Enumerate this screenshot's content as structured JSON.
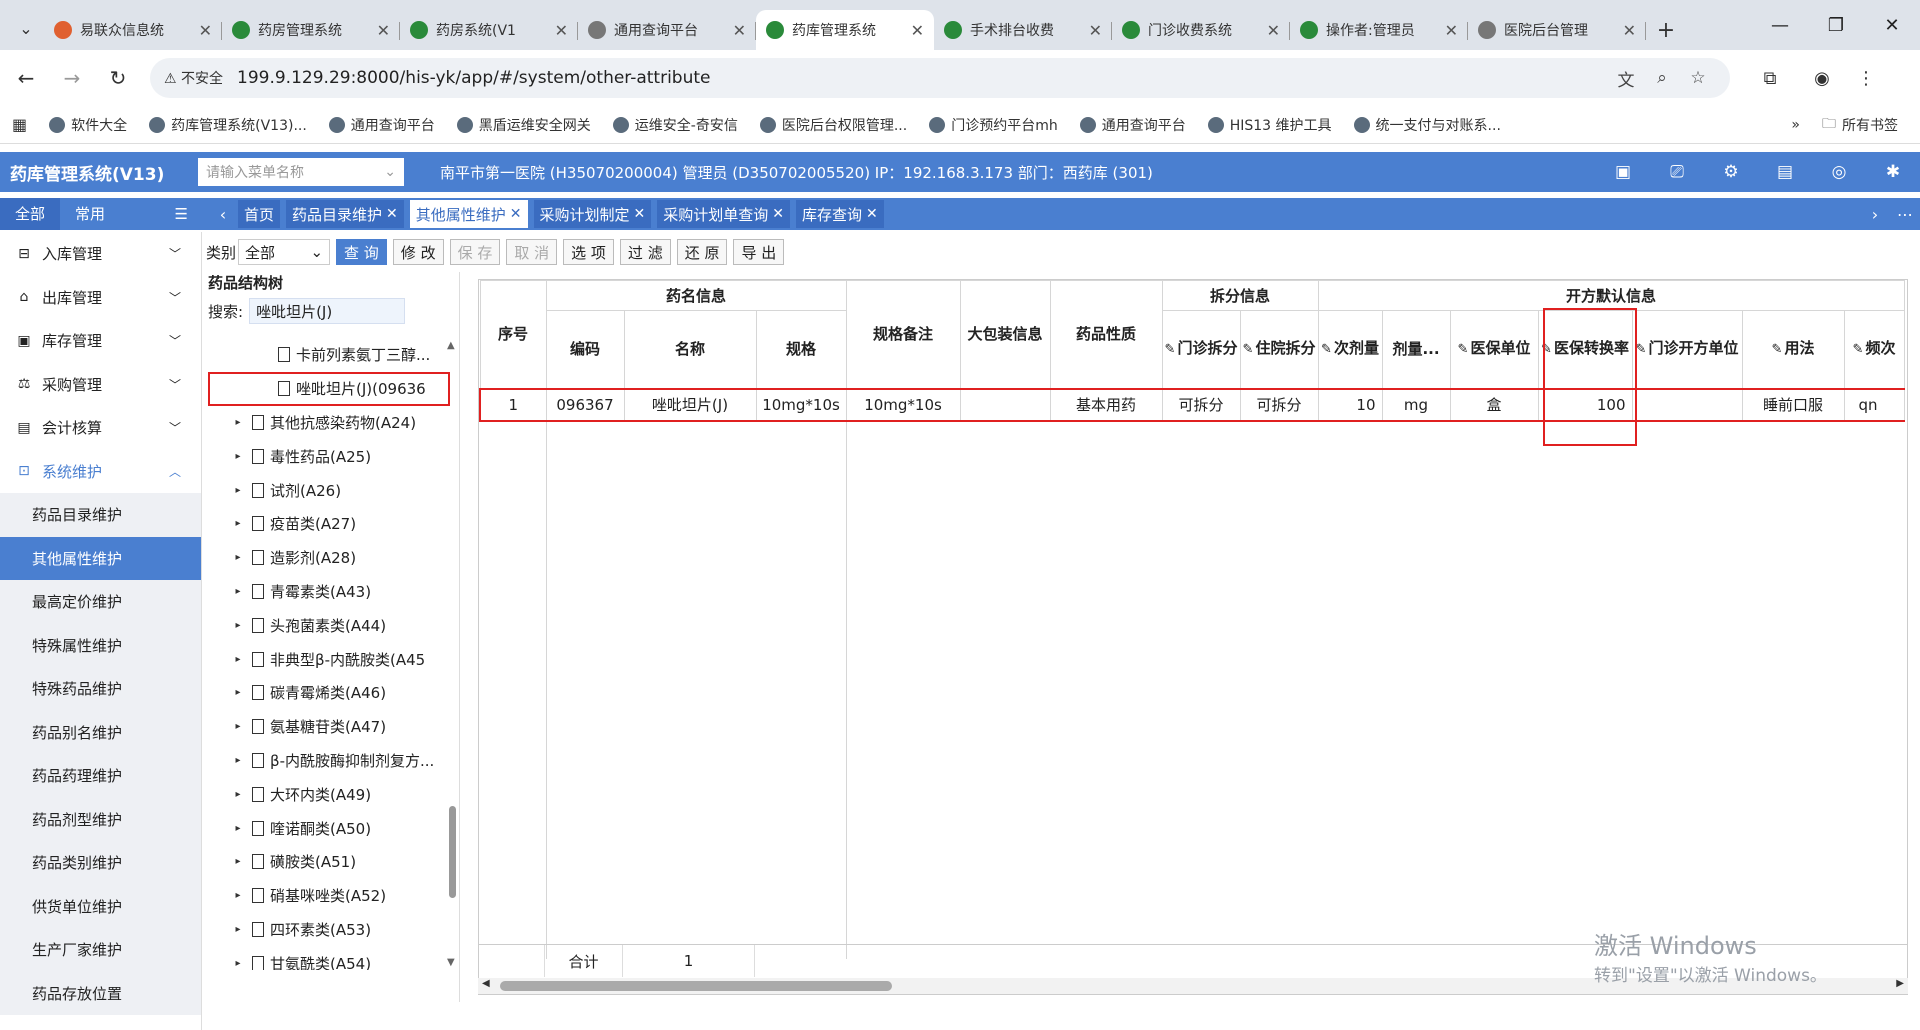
{
  "browser": {
    "tabs": [
      {
        "title": "易联众信息统",
        "color": "#e06030"
      },
      {
        "title": "药房管理系统",
        "color": "#2a8a3a"
      },
      {
        "title": "药房系统(V1",
        "color": "#2a8a3a"
      },
      {
        "title": "通用查询平台",
        "color": "#777777"
      },
      {
        "title": "药库管理系统",
        "color": "#2a8a3a",
        "active": true
      },
      {
        "title": "手术排台收费",
        "color": "#2a8a3a"
      },
      {
        "title": "门诊收费系统",
        "color": "#2a8a3a"
      },
      {
        "title": "操作者:管理员",
        "color": "#2a8a3a"
      },
      {
        "title": "医院后台管理",
        "color": "#777777"
      }
    ],
    "security_label": "不安全",
    "url": "199.9.129.29:8000/his-yk/app/#/system/other-attribute",
    "bookmarks": [
      {
        "label": "软件大全"
      },
      {
        "label": "药库管理系统(V13)..."
      },
      {
        "label": "通用查询平台"
      },
      {
        "label": "黑盾运维安全网关"
      },
      {
        "label": "运维安全-奇安信"
      },
      {
        "label": "医院后台权限管理..."
      },
      {
        "label": "门诊预约平台mh"
      },
      {
        "label": "通用查询平台"
      },
      {
        "label": "HIS13 维护工具"
      },
      {
        "label": "统一支付与对账系..."
      }
    ],
    "all_bookmarks_label": "所有书签"
  },
  "app": {
    "title": "药库管理系统(V13)",
    "menu_search_placeholder": "请输入菜单名称",
    "header_info": "南平市第一医院 (H35070200004) 管理员 (D350702005520) IP：192.168.3.173 部门：西药库 (301)",
    "accent_color": "#4a7fd0"
  },
  "left_tabs": {
    "all": "全部",
    "common": "常用"
  },
  "page_tabs": [
    {
      "label": "首页",
      "closable": false
    },
    {
      "label": "药品目录维护",
      "closable": true
    },
    {
      "label": "其他属性维护",
      "closable": true,
      "active": true
    },
    {
      "label": "采购计划制定",
      "closable": true
    },
    {
      "label": "采购计划单查询",
      "closable": true
    },
    {
      "label": "库存查询",
      "closable": true
    }
  ],
  "sidebar": {
    "groups": [
      {
        "label": "入库管理",
        "icon": "inbox-icon"
      },
      {
        "label": "出库管理",
        "icon": "outbox-icon"
      },
      {
        "label": "库存管理",
        "icon": "stock-icon"
      },
      {
        "label": "采购管理",
        "icon": "purchase-icon"
      },
      {
        "label": "会计核算",
        "icon": "accounting-icon"
      },
      {
        "label": "系统维护",
        "icon": "system-icon",
        "open": true
      }
    ],
    "sub_items": [
      {
        "label": "药品目录维护"
      },
      {
        "label": "其他属性维护",
        "active": true
      },
      {
        "label": "最高定价维护"
      },
      {
        "label": "特殊属性维护"
      },
      {
        "label": "特殊药品维护"
      },
      {
        "label": "药品别名维护"
      },
      {
        "label": "药品药理维护"
      },
      {
        "label": "药品剂型维护"
      },
      {
        "label": "药品类别维护"
      },
      {
        "label": "供货单位维护"
      },
      {
        "label": "生产厂家维护"
      },
      {
        "label": "药品存放位置"
      }
    ]
  },
  "toolbar": {
    "category_label": "类别",
    "category_value": "全部",
    "buttons": [
      {
        "label": "查 询",
        "primary": true
      },
      {
        "label": "修 改"
      },
      {
        "label": "保 存",
        "disabled": true
      },
      {
        "label": "取 消",
        "disabled": true
      },
      {
        "label": "选 项"
      },
      {
        "label": "过 滤"
      },
      {
        "label": "还 原"
      },
      {
        "label": "导 出"
      }
    ]
  },
  "tree": {
    "title": "药品结构树",
    "search_label": "搜索:",
    "search_value": "唑吡坦片(J)",
    "leaf_items": [
      {
        "label": "卡前列素氨丁三醇..."
      },
      {
        "label": "唑吡坦片(J)(09636",
        "selected": true
      }
    ],
    "nodes": [
      {
        "label": "其他抗感染药物(A24)"
      },
      {
        "label": "毒性药品(A25)"
      },
      {
        "label": "试剂(A26)"
      },
      {
        "label": "疫苗类(A27)"
      },
      {
        "label": "造影剂(A28)"
      },
      {
        "label": "青霉素类(A43)"
      },
      {
        "label": "头孢菌素类(A44)"
      },
      {
        "label": "非典型β-内酰胺类(A45"
      },
      {
        "label": "碳青霉烯类(A46)"
      },
      {
        "label": "氨基糖苷类(A47)"
      },
      {
        "label": "β-内酰胺酶抑制剂复方..."
      },
      {
        "label": "大环内类(A49)"
      },
      {
        "label": "喹诺酮类(A50)"
      },
      {
        "label": "磺胺类(A51)"
      },
      {
        "label": "硝基咪唑类(A52)"
      },
      {
        "label": "四环素类(A53)"
      },
      {
        "label": "甘氨酰类(A54)"
      }
    ]
  },
  "grid": {
    "group_headers": {
      "drug_info": "药名信息",
      "split_info": "拆分信息",
      "prescribe_info": "开方默认信息"
    },
    "columns": {
      "seq": "序号",
      "code": "编码",
      "name": "名称",
      "spec": "规格",
      "spec_note": "规格备注",
      "big_pack": "大包装信息",
      "nature": "药品性质",
      "outpatient_split": "门诊拆分",
      "inpatient_split": "住院拆分",
      "dose_qty": "次剂量",
      "dose_unit": "剂量...",
      "insurance_unit": "医保单位",
      "insurance_rate": "医保转换率",
      "outpatient_unit": "门诊开方单位",
      "usage": "用法",
      "freq": "频次"
    },
    "rows": [
      {
        "seq": "1",
        "code": "096367",
        "name": "唑吡坦片(J)",
        "spec": "10mg*10s",
        "spec_note": "10mg*10s",
        "big_pack": "",
        "nature": "基本用药",
        "outpatient_split": "可拆分",
        "inpatient_split": "可拆分",
        "dose_qty": "10",
        "dose_unit": "mg",
        "insurance_unit": "盒",
        "insurance_rate": "100",
        "outpatient_unit": "",
        "usage": "睡前口服",
        "freq": "qn"
      }
    ],
    "footer_label": "合计",
    "footer_count": "1"
  },
  "watermark": {
    "line1": "激活 Windows",
    "line2": "转到\"设置\"以激活 Windows。"
  }
}
